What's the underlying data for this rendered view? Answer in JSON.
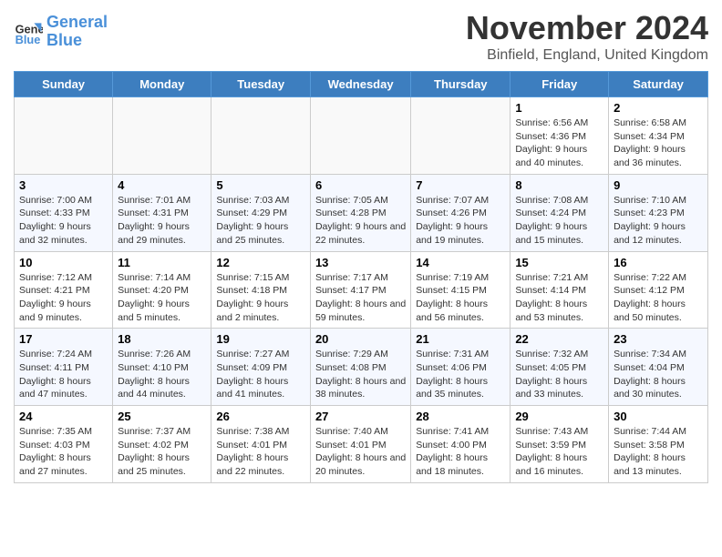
{
  "header": {
    "logo_line1": "General",
    "logo_line2": "Blue",
    "month_title": "November 2024",
    "location": "Binfield, England, United Kingdom"
  },
  "weekdays": [
    "Sunday",
    "Monday",
    "Tuesday",
    "Wednesday",
    "Thursday",
    "Friday",
    "Saturday"
  ],
  "weeks": [
    [
      {
        "day": "",
        "info": ""
      },
      {
        "day": "",
        "info": ""
      },
      {
        "day": "",
        "info": ""
      },
      {
        "day": "",
        "info": ""
      },
      {
        "day": "",
        "info": ""
      },
      {
        "day": "1",
        "info": "Sunrise: 6:56 AM\nSunset: 4:36 PM\nDaylight: 9 hours and 40 minutes."
      },
      {
        "day": "2",
        "info": "Sunrise: 6:58 AM\nSunset: 4:34 PM\nDaylight: 9 hours and 36 minutes."
      }
    ],
    [
      {
        "day": "3",
        "info": "Sunrise: 7:00 AM\nSunset: 4:33 PM\nDaylight: 9 hours and 32 minutes."
      },
      {
        "day": "4",
        "info": "Sunrise: 7:01 AM\nSunset: 4:31 PM\nDaylight: 9 hours and 29 minutes."
      },
      {
        "day": "5",
        "info": "Sunrise: 7:03 AM\nSunset: 4:29 PM\nDaylight: 9 hours and 25 minutes."
      },
      {
        "day": "6",
        "info": "Sunrise: 7:05 AM\nSunset: 4:28 PM\nDaylight: 9 hours and 22 minutes."
      },
      {
        "day": "7",
        "info": "Sunrise: 7:07 AM\nSunset: 4:26 PM\nDaylight: 9 hours and 19 minutes."
      },
      {
        "day": "8",
        "info": "Sunrise: 7:08 AM\nSunset: 4:24 PM\nDaylight: 9 hours and 15 minutes."
      },
      {
        "day": "9",
        "info": "Sunrise: 7:10 AM\nSunset: 4:23 PM\nDaylight: 9 hours and 12 minutes."
      }
    ],
    [
      {
        "day": "10",
        "info": "Sunrise: 7:12 AM\nSunset: 4:21 PM\nDaylight: 9 hours and 9 minutes."
      },
      {
        "day": "11",
        "info": "Sunrise: 7:14 AM\nSunset: 4:20 PM\nDaylight: 9 hours and 5 minutes."
      },
      {
        "day": "12",
        "info": "Sunrise: 7:15 AM\nSunset: 4:18 PM\nDaylight: 9 hours and 2 minutes."
      },
      {
        "day": "13",
        "info": "Sunrise: 7:17 AM\nSunset: 4:17 PM\nDaylight: 8 hours and 59 minutes."
      },
      {
        "day": "14",
        "info": "Sunrise: 7:19 AM\nSunset: 4:15 PM\nDaylight: 8 hours and 56 minutes."
      },
      {
        "day": "15",
        "info": "Sunrise: 7:21 AM\nSunset: 4:14 PM\nDaylight: 8 hours and 53 minutes."
      },
      {
        "day": "16",
        "info": "Sunrise: 7:22 AM\nSunset: 4:12 PM\nDaylight: 8 hours and 50 minutes."
      }
    ],
    [
      {
        "day": "17",
        "info": "Sunrise: 7:24 AM\nSunset: 4:11 PM\nDaylight: 8 hours and 47 minutes."
      },
      {
        "day": "18",
        "info": "Sunrise: 7:26 AM\nSunset: 4:10 PM\nDaylight: 8 hours and 44 minutes."
      },
      {
        "day": "19",
        "info": "Sunrise: 7:27 AM\nSunset: 4:09 PM\nDaylight: 8 hours and 41 minutes."
      },
      {
        "day": "20",
        "info": "Sunrise: 7:29 AM\nSunset: 4:08 PM\nDaylight: 8 hours and 38 minutes."
      },
      {
        "day": "21",
        "info": "Sunrise: 7:31 AM\nSunset: 4:06 PM\nDaylight: 8 hours and 35 minutes."
      },
      {
        "day": "22",
        "info": "Sunrise: 7:32 AM\nSunset: 4:05 PM\nDaylight: 8 hours and 33 minutes."
      },
      {
        "day": "23",
        "info": "Sunrise: 7:34 AM\nSunset: 4:04 PM\nDaylight: 8 hours and 30 minutes."
      }
    ],
    [
      {
        "day": "24",
        "info": "Sunrise: 7:35 AM\nSunset: 4:03 PM\nDaylight: 8 hours and 27 minutes."
      },
      {
        "day": "25",
        "info": "Sunrise: 7:37 AM\nSunset: 4:02 PM\nDaylight: 8 hours and 25 minutes."
      },
      {
        "day": "26",
        "info": "Sunrise: 7:38 AM\nSunset: 4:01 PM\nDaylight: 8 hours and 22 minutes."
      },
      {
        "day": "27",
        "info": "Sunrise: 7:40 AM\nSunset: 4:01 PM\nDaylight: 8 hours and 20 minutes."
      },
      {
        "day": "28",
        "info": "Sunrise: 7:41 AM\nSunset: 4:00 PM\nDaylight: 8 hours and 18 minutes."
      },
      {
        "day": "29",
        "info": "Sunrise: 7:43 AM\nSunset: 3:59 PM\nDaylight: 8 hours and 16 minutes."
      },
      {
        "day": "30",
        "info": "Sunrise: 7:44 AM\nSunset: 3:58 PM\nDaylight: 8 hours and 13 minutes."
      }
    ]
  ]
}
